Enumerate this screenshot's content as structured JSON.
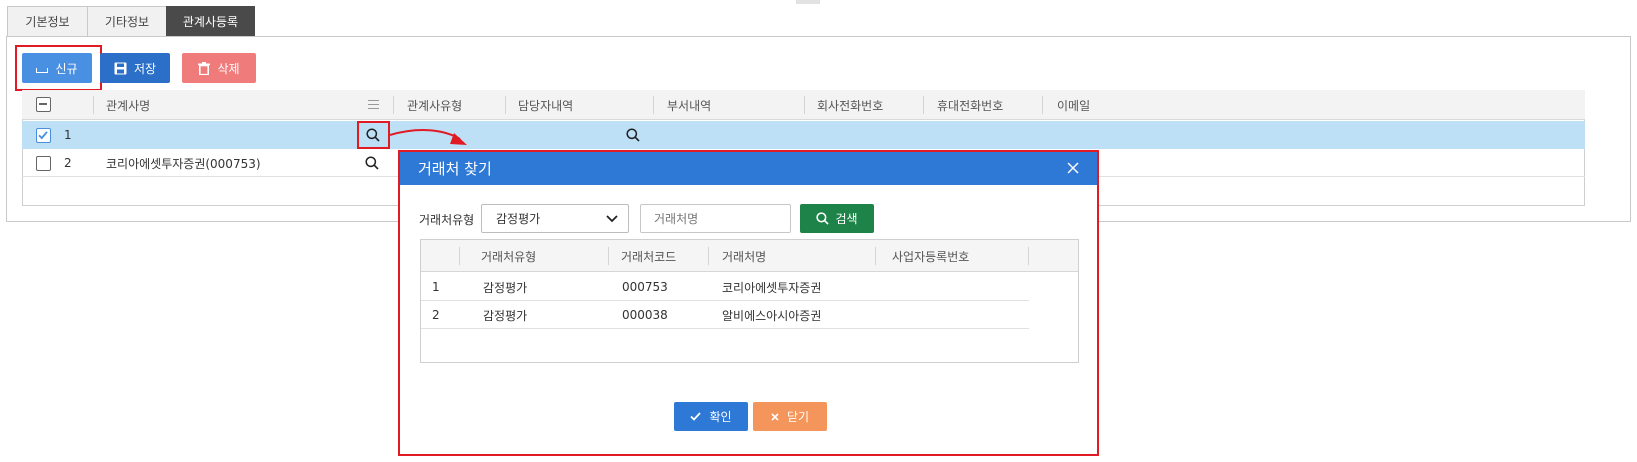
{
  "tabs": [
    {
      "label": "기본정보"
    },
    {
      "label": "기타정보"
    },
    {
      "label": "관계사등록"
    }
  ],
  "toolbar": {
    "new_label": "신규",
    "save_label": "저장",
    "delete_label": "삭제"
  },
  "grid": {
    "columns": [
      "관계사명",
      "관계사유형",
      "담당자내역",
      "부서내역",
      "회사전화번호",
      "휴대전화번호",
      "이메일"
    ],
    "rows": [
      {
        "no": "1",
        "name": ""
      },
      {
        "no": "2",
        "name": "코리아에셋투자증권(000753)"
      }
    ]
  },
  "modal": {
    "title": "거래처 찾기",
    "type_label": "거래처유형",
    "type_value": "감정평가",
    "name_placeholder": "거래처명",
    "search_label": "검색",
    "columns": [
      "거래처유형",
      "거래처코드",
      "거래처명",
      "사업자등록번호"
    ],
    "rows": [
      {
        "no": "1",
        "type": "감정평가",
        "code": "000753",
        "name": "코리아에셋투자증권",
        "bizno": ""
      },
      {
        "no": "2",
        "type": "감정평가",
        "code": "000038",
        "name": "알비에스아시아증권",
        "bizno": ""
      }
    ],
    "ok_label": "확인",
    "close_label": "닫기"
  },
  "colors": {
    "accent": "#2e78d6",
    "annotation": "#e01b24",
    "selected_row": "#bde0f7",
    "search_button": "#1d8348",
    "close_button": "#f4955c",
    "delete_button": "#f07b7b"
  }
}
